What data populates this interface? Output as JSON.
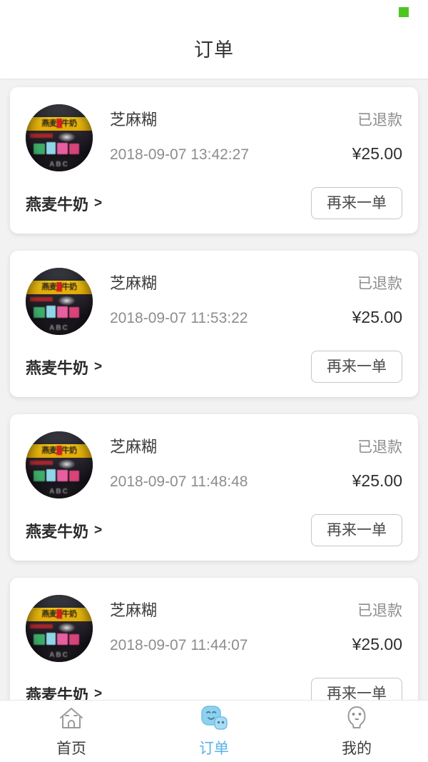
{
  "header": {
    "title": "订单",
    "status_indicator_color": "#4dc71f"
  },
  "orders": [
    {
      "product_name": "芝麻糊",
      "status": "已退款",
      "time": "2018-09-07 13:42:27",
      "price": "¥25.00",
      "shop_name": "燕麦牛奶",
      "shop_chevron": ">",
      "reorder_label": "再来一单",
      "thumbnail_sign_left": "燕麦",
      "thumbnail_sign_right": "牛奶",
      "thumbnail_bottom_text": "ABC"
    },
    {
      "product_name": "芝麻糊",
      "status": "已退款",
      "time": "2018-09-07 11:53:22",
      "price": "¥25.00",
      "shop_name": "燕麦牛奶",
      "shop_chevron": ">",
      "reorder_label": "再来一单",
      "thumbnail_sign_left": "燕麦",
      "thumbnail_sign_right": "牛奶",
      "thumbnail_bottom_text": "ABC"
    },
    {
      "product_name": "芝麻糊",
      "status": "已退款",
      "time": "2018-09-07 11:48:48",
      "price": "¥25.00",
      "shop_name": "燕麦牛奶",
      "shop_chevron": ">",
      "reorder_label": "再来一单",
      "thumbnail_sign_left": "燕麦",
      "thumbnail_sign_right": "牛奶",
      "thumbnail_bottom_text": "ABC"
    },
    {
      "product_name": "芝麻糊",
      "status": "已退款",
      "time": "2018-09-07 11:44:07",
      "price": "¥25.00",
      "shop_name": "燕麦牛奶",
      "shop_chevron": ">",
      "reorder_label": "再来一单",
      "thumbnail_sign_left": "燕麦",
      "thumbnail_sign_right": "牛奶",
      "thumbnail_bottom_text": "ABC"
    }
  ],
  "tabbar": {
    "active_color": "#5bb3e8",
    "inactive_color": "#3c3c3c",
    "items": [
      {
        "label": "首页",
        "icon": "home-icon",
        "active": false
      },
      {
        "label": "订单",
        "icon": "orders-face-icon",
        "active": true
      },
      {
        "label": "我的",
        "icon": "profile-icon",
        "active": false
      }
    ]
  }
}
